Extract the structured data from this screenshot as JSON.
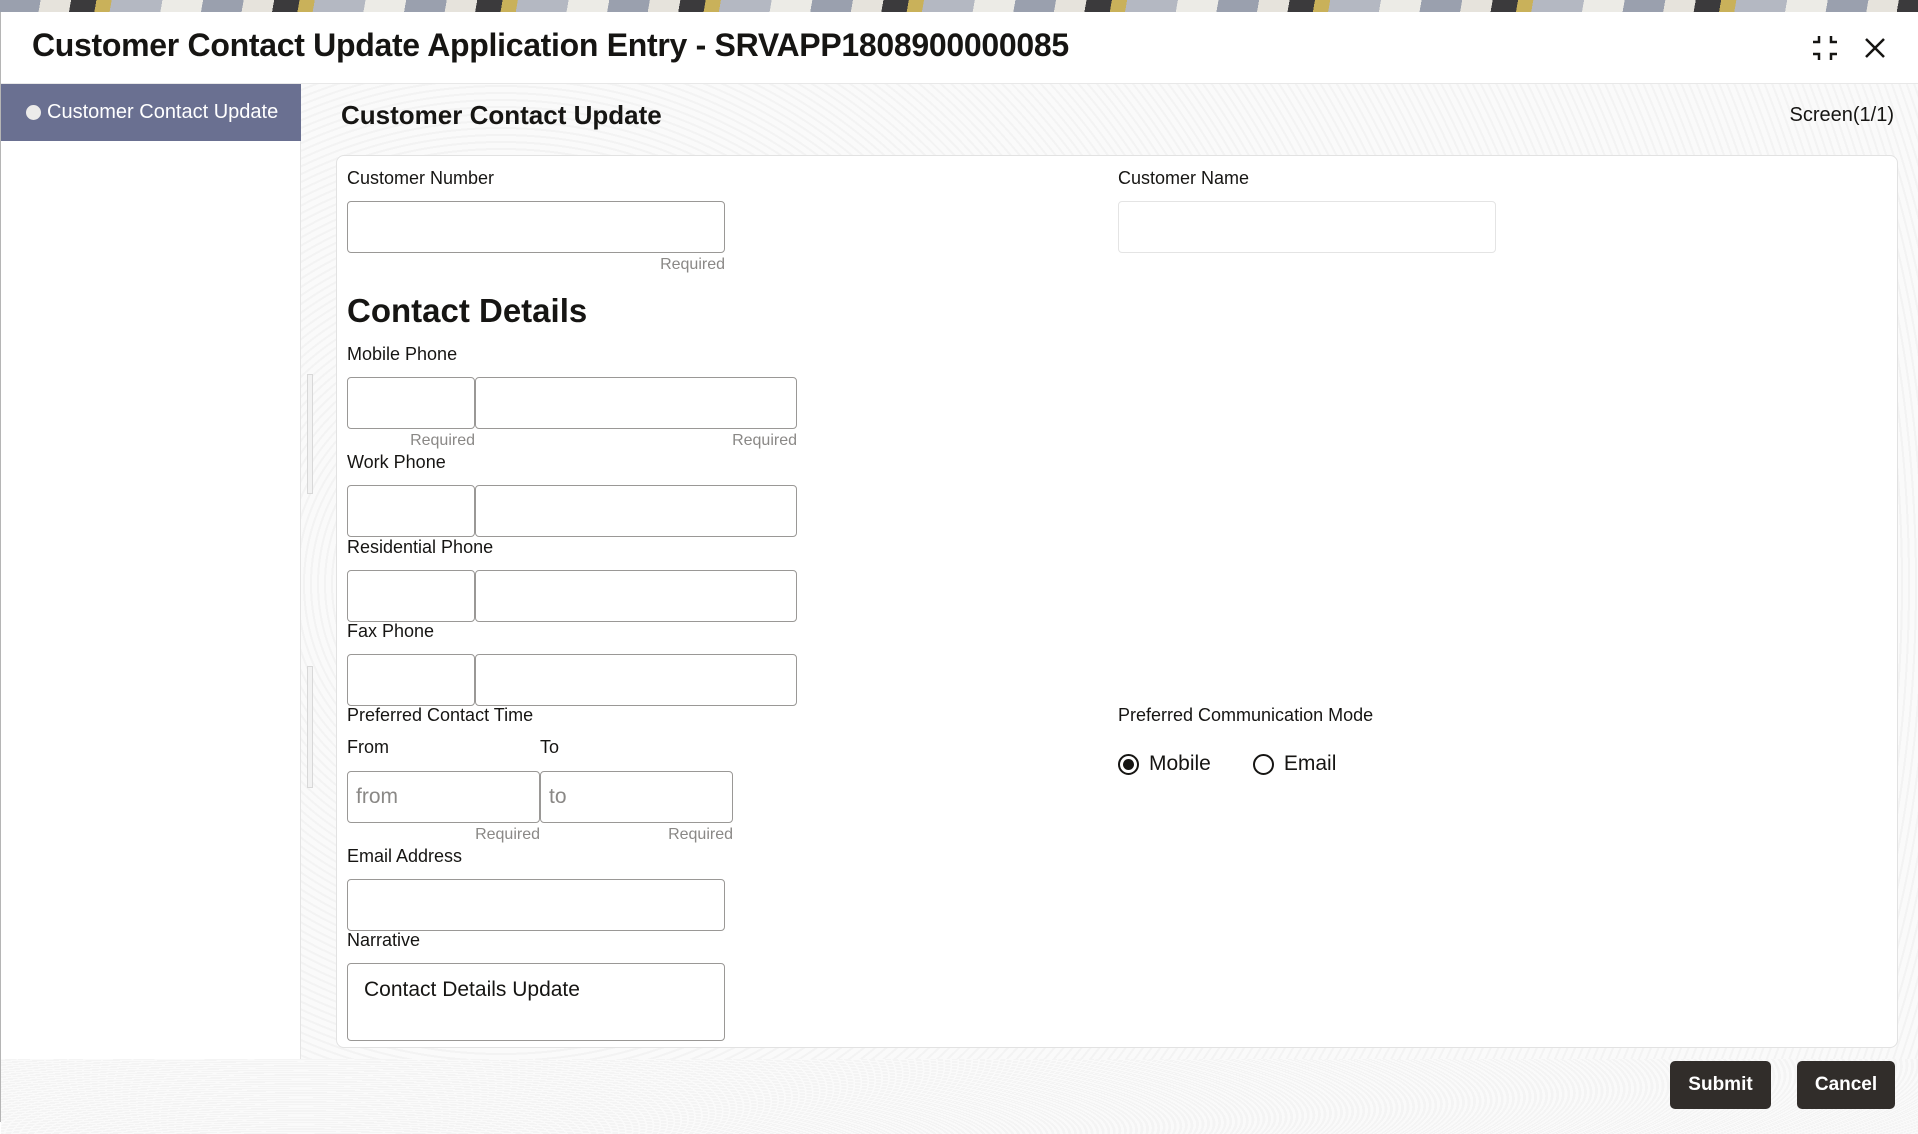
{
  "window": {
    "title": "Customer Contact Update Application Entry - SRVAPP1808900000085",
    "icons": {
      "minimize": "minimize-icon",
      "close": "close-icon"
    }
  },
  "sidebar": {
    "items": [
      {
        "label": "Customer Contact Update",
        "active": true,
        "icon": "bullet-icon"
      }
    ]
  },
  "main": {
    "section_title": "Customer Contact Update",
    "screen_indicator": "Screen(1/1)"
  },
  "form": {
    "customer_number": {
      "label": "Customer Number",
      "value": "",
      "hint": "Required"
    },
    "customer_name": {
      "label": "Customer Name",
      "value": ""
    },
    "contact_details_heading": "Contact Details",
    "mobile_phone": {
      "label": "Mobile Phone",
      "code_value": "",
      "number_value": "",
      "code_hint": "Required",
      "number_hint": "Required"
    },
    "work_phone": {
      "label": "Work Phone",
      "code_value": "",
      "number_value": ""
    },
    "residential_phone": {
      "label": "Residential Phone",
      "code_value": "",
      "number_value": ""
    },
    "fax_phone": {
      "label": "Fax Phone",
      "code_value": "",
      "number_value": ""
    },
    "preferred_contact_time": {
      "label": "Preferred Contact Time",
      "from": {
        "label": "From",
        "placeholder": "from",
        "value": "",
        "hint": "Required"
      },
      "to": {
        "label": "To",
        "placeholder": "to",
        "value": "",
        "hint": "Required"
      }
    },
    "email_address": {
      "label": "Email Address",
      "value": ""
    },
    "narrative": {
      "label": "Narrative",
      "value": "Contact Details Update"
    },
    "preferred_communication_mode": {
      "label": "Preferred Communication Mode",
      "options": [
        {
          "label": "Mobile",
          "selected": true
        },
        {
          "label": "Email",
          "selected": false
        }
      ]
    }
  },
  "footer": {
    "submit_label": "Submit",
    "cancel_label": "Cancel"
  }
}
